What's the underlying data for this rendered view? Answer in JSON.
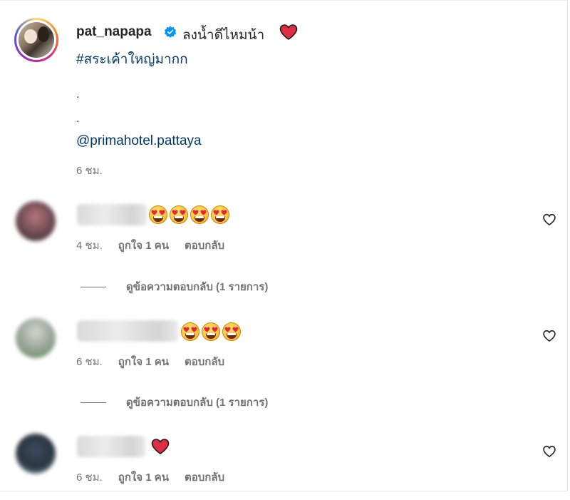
{
  "post": {
    "username": "pat_napapa",
    "caption": "ลงน้ำดีไหมน้า",
    "hashtag": "#สระเค้าใหญ่มากก",
    "dot1": ".",
    "dot2": ".",
    "mention": "@primahotel.pattaya",
    "time": "6 ชม."
  },
  "comments": [
    {
      "emoji_count": 4,
      "emoji": "heart-eyes-emoji",
      "time": "4 ชม.",
      "likes": "ถูกใจ 1 คน",
      "reply": "ตอบกลับ",
      "view_replies": "ดูข้อความตอบกลับ (1 รายการ)"
    },
    {
      "emoji_count": 3,
      "emoji": "heart-eyes-emoji",
      "time": "6 ชม.",
      "likes": "ถูกใจ 1 คน",
      "reply": "ตอบกลับ",
      "view_replies": "ดูข้อความตอบกลับ (1 รายการ)"
    },
    {
      "emoji_count": 1,
      "emoji": "red-heart-emoji",
      "time": "6 ชม.",
      "likes": "ถูกใจ 1 คน",
      "reply": "ตอบกลับ"
    }
  ],
  "colors": {
    "link": "#00376b",
    "muted": "#737373",
    "text": "#262626",
    "verified": "#0095f6",
    "heart": "#e0245e"
  }
}
